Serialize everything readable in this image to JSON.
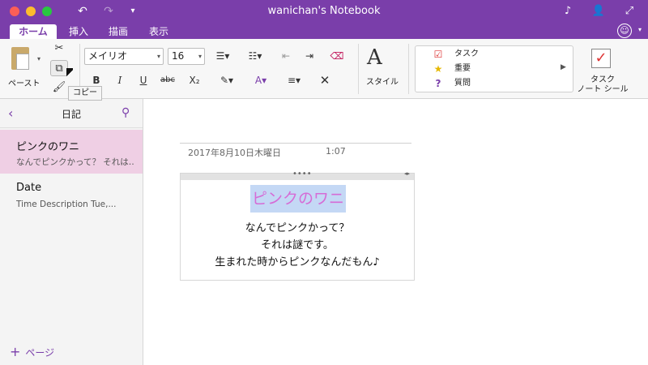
{
  "window": {
    "title": "wanichan's Notebook"
  },
  "tabs": [
    {
      "label": "ホーム",
      "active": true
    },
    {
      "label": "挿入",
      "active": false
    },
    {
      "label": "描画",
      "active": false
    },
    {
      "label": "表示",
      "active": false
    }
  ],
  "ribbon": {
    "paste_label": "ペースト",
    "copy_tooltip": "コピー",
    "font_name": "メイリオ",
    "font_size": "16",
    "bold": "B",
    "italic": "I",
    "underline": "U",
    "strike": "abc",
    "subscript": "X₂",
    "styles_label": "スタイル",
    "tags": [
      {
        "label": "タスク",
        "icon": "checkbox-icon"
      },
      {
        "label": "重要",
        "icon": "star-icon"
      },
      {
        "label": "質問",
        "icon": "question-icon"
      }
    ],
    "todo_tag_label_line1": "タスク",
    "todo_tag_label_line2": "ノート シール"
  },
  "pages_pane": {
    "section_title": "日記",
    "pages": [
      {
        "title": "ピンクのワニ",
        "snippet": "なんでピンクかって？ それは…",
        "selected": true
      },
      {
        "title": "Date",
        "snippet": "Time  Description  Tue,...",
        "selected": false
      }
    ],
    "add_page_label": "ページ"
  },
  "note": {
    "date": "2017年8月10日木曜日",
    "time": "1:07",
    "title": "ピンクのワニ",
    "lines": [
      "なんでピンクかって？",
      "それは謎です。",
      "生まれた時からピンクなんだもん♪"
    ]
  },
  "colors": {
    "accent": "#7a3eaa",
    "selected_page_bg": "#efcfe4",
    "highlight_bg": "#c4d8f5",
    "title_text": "#d66cd6"
  }
}
